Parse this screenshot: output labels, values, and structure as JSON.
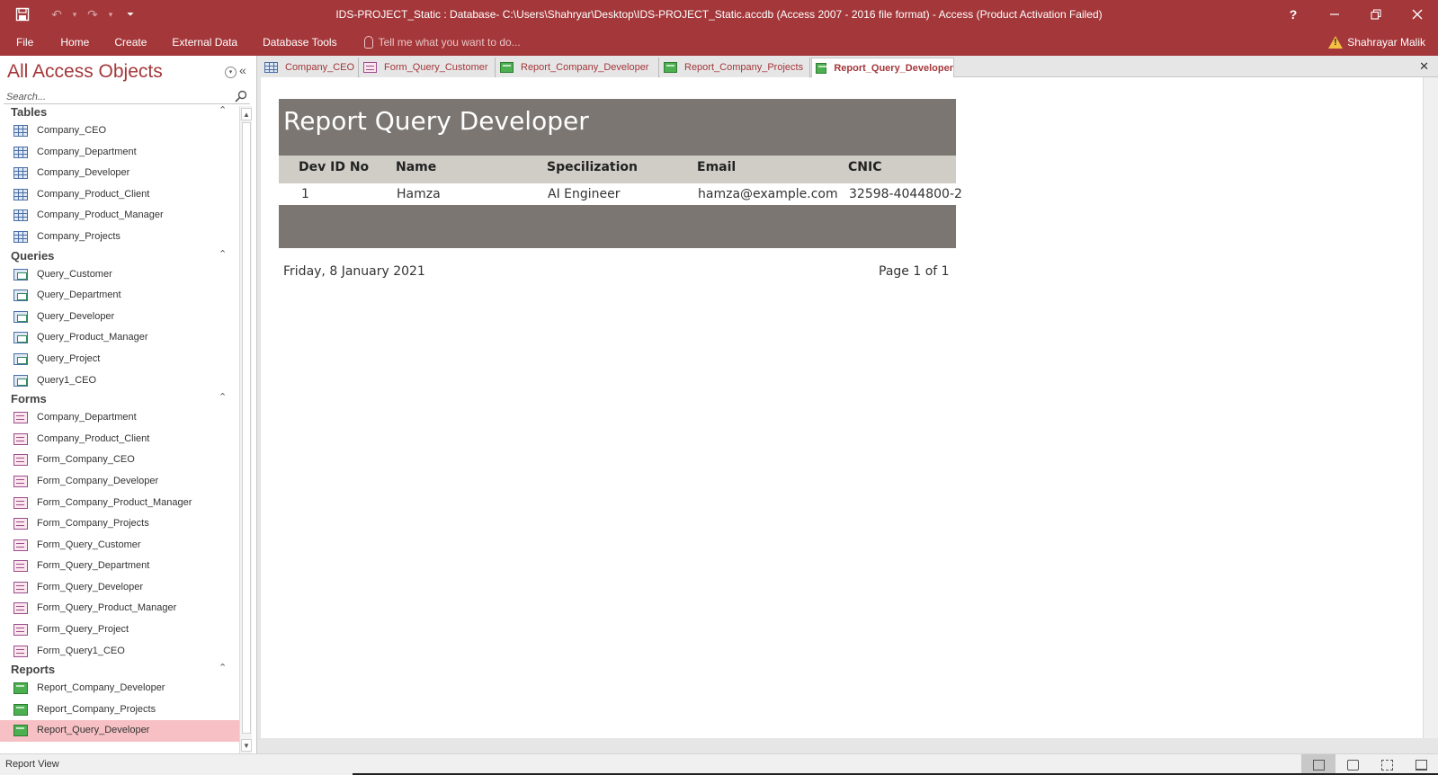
{
  "window": {
    "title": "IDS-PROJECT_Static : Database- C:\\Users\\Shahryar\\Desktop\\IDS-PROJECT_Static.accdb (Access 2007 - 2016 file format) - Access (Product Activation Failed)",
    "help_glyph": "?",
    "min_glyph": "—",
    "restore_glyph": "❐",
    "close_glyph": "✕"
  },
  "quick_access": {
    "save_glyph": "💾",
    "undo_glyph": "↶",
    "redo_glyph": "↷",
    "dropdown_glyph": "▾",
    "customize_glyph": "⏷"
  },
  "ribbon": {
    "tabs": [
      "File",
      "Home",
      "Create",
      "External Data",
      "Database Tools"
    ],
    "tell_me_placeholder": "Tell me what you want to do...",
    "user_name": "Shahrayar Malik"
  },
  "nav": {
    "title": "All Access Objects",
    "menu_glyph": "▾",
    "collapse_glyph": "«",
    "search_placeholder": "Search...",
    "groups": [
      {
        "name": "Tables",
        "type": "table",
        "items": [
          "Company_CEO",
          "Company_Department",
          "Company_Developer",
          "Company_Product_Client",
          "Company_Product_Manager",
          "Company_Projects"
        ]
      },
      {
        "name": "Queries",
        "type": "query",
        "items": [
          "Query_Customer",
          "Query_Department",
          "Query_Developer",
          "Query_Product_Manager",
          "Query_Project",
          "Query1_CEO"
        ]
      },
      {
        "name": "Forms",
        "type": "form",
        "items": [
          "Company_Department",
          "Company_Product_Client",
          "Form_Company_CEO",
          "Form_Company_Developer",
          "Form_Company_Product_Manager",
          "Form_Company_Projects",
          "Form_Query_Customer",
          "Form_Query_Department",
          "Form_Query_Developer",
          "Form_Query_Product_Manager",
          "Form_Query_Project",
          "Form_Query1_CEO"
        ]
      },
      {
        "name": "Reports",
        "type": "report",
        "items": [
          "Report_Company_Developer",
          "Report_Company_Projects",
          "Report_Query_Developer"
        ]
      }
    ],
    "selected_item": "Report_Query_Developer",
    "group_chevron": "⌃"
  },
  "doc_tabs": [
    {
      "label": "Company_CEO",
      "type": "table",
      "active": false
    },
    {
      "label": "Form_Query_Customer",
      "type": "form",
      "active": false
    },
    {
      "label": "Report_Company_Developer",
      "type": "report",
      "active": false
    },
    {
      "label": "Report_Company_Projects",
      "type": "report",
      "active": false
    },
    {
      "label": "Report_Query_Developer",
      "type": "report",
      "active": true
    }
  ],
  "close_doc_glyph": "✕",
  "report": {
    "title": "Report Query Developer",
    "columns": [
      "Dev ID No",
      "Name",
      "Specilization",
      "Email",
      "CNIC"
    ],
    "rows": [
      [
        "1",
        "Hamza",
        "AI Engineer",
        "hamza@example.com",
        "32598-4044800-2"
      ]
    ],
    "date": "Friday, 8 January 2021",
    "page": "Page 1 of 1",
    "header_color": "#7b7671",
    "colhead_color": "#d0cdc7"
  },
  "status": {
    "text": "Report View"
  },
  "colors": {
    "accent": "#a4373a",
    "selected_bg": "#f6c0c4"
  }
}
